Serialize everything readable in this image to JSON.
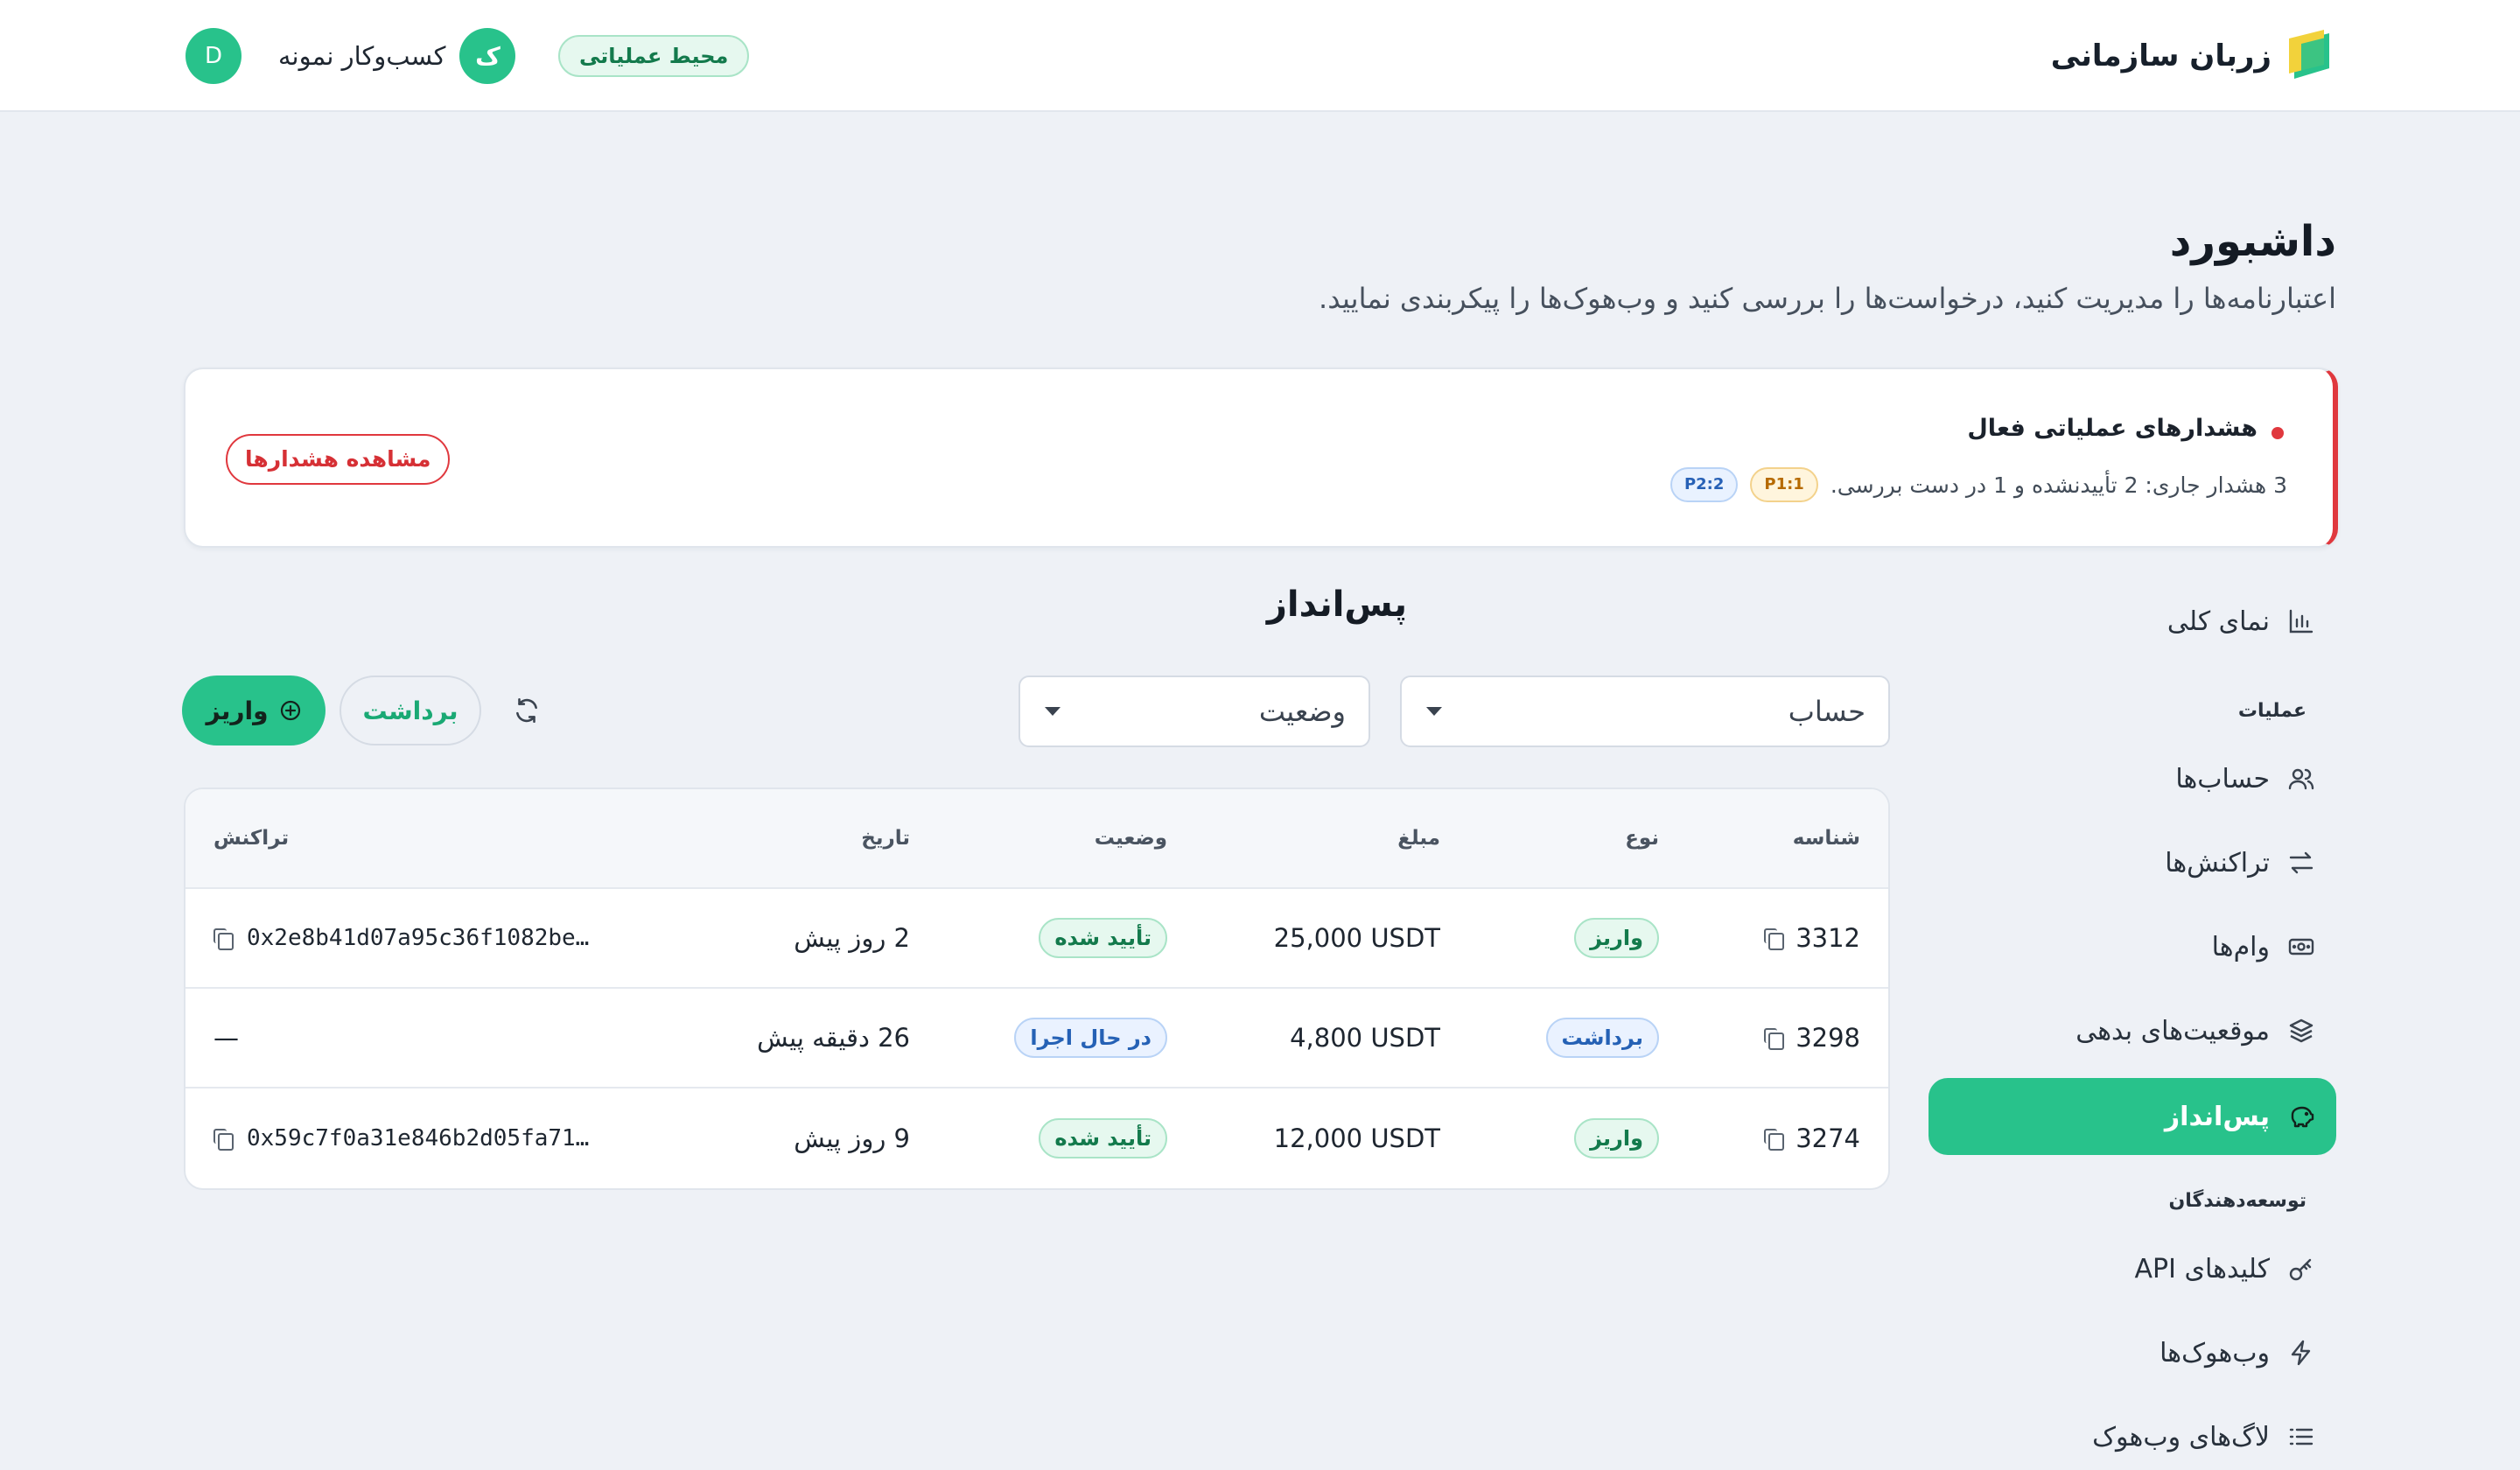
{
  "app": {
    "brand_name": "زربان سازمانی",
    "environment_badge": "محیط عملیاتی",
    "business_avatar_letter": "ک",
    "business_name": "کسب‌وکار نمونه",
    "user_avatar_letter": "D"
  },
  "header": {
    "title": "داشبورد",
    "subtitle": "اعتبارنامه‌ها را مدیریت کنید، درخواست‌ها را بررسی کنید و وب‌هوک‌ها را پیکربندی نمایید."
  },
  "alert": {
    "title": "هشدارهای عملیاتی فعال",
    "text": "3 هشدار جاری: 2 تأییدنشده و 1 در دست بررسی.",
    "p1": "P1:1",
    "p2": "P2:2",
    "button": "مشاهده هشدارها"
  },
  "sidebar": {
    "overview": "نمای کلی",
    "section_operations": "عملیات",
    "accounts": "حساب‌ها",
    "transactions": "تراکنش‌ها",
    "loans": "وام‌ها",
    "debt_positions": "موقعیت‌های بدهی",
    "savings": "پس‌انداز",
    "section_developers": "توسعه‌دهندگان",
    "api_keys": "کلیدهای API",
    "webhooks": "وب‌هوک‌ها",
    "webhook_logs": "لاگ‌های وب‌هوک"
  },
  "savings": {
    "title": "پس‌انداز",
    "account_select": "حساب",
    "status_select": "وضعیت",
    "deposit_button": "واریز",
    "withdraw_button": "برداشت"
  },
  "table": {
    "headers": {
      "id": "شناسه",
      "type": "نوع",
      "amount": "مبلغ",
      "status": "وضعیت",
      "date": "تاریخ",
      "tx": "تراکنش"
    },
    "rows": [
      {
        "id": "3312",
        "type": "واریز",
        "amount": "25,000 USDT",
        "status": "تأیید شده",
        "date": "2 روز پیش",
        "tx": "0x2e8b41d07a95c36f1082be…"
      },
      {
        "id": "3298",
        "type": "برداشت",
        "amount": "4,800 USDT",
        "status": "در حال اجرا",
        "date": "26 دقیقه پیش",
        "tx": "—"
      },
      {
        "id": "3274",
        "type": "واریز",
        "amount": "12,000 USDT",
        "status": "تأیید شده",
        "date": "9 روز پیش",
        "tx": "0x59c7f0a31e846b2d05fa71…"
      }
    ]
  },
  "colors": {
    "accent": "#28c28b",
    "danger": "#e0383e",
    "background": "#eef1f6"
  }
}
